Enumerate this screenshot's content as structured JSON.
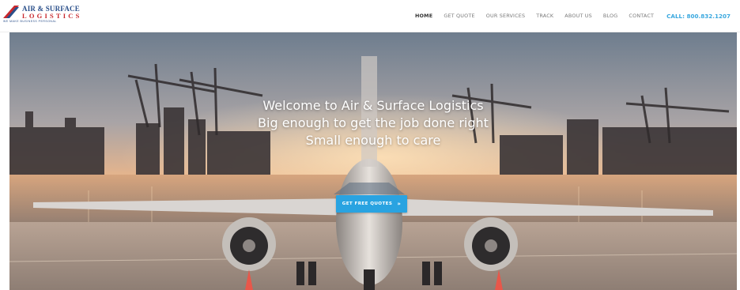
{
  "header": {
    "logo": {
      "line1": "AIR & SURFACE",
      "line2": "LOGISTICS",
      "tagline": "WE MAKE BUSINESS PERSONAL"
    },
    "nav": [
      {
        "label": "HOME",
        "active": true
      },
      {
        "label": "GET QUOTE",
        "active": false
      },
      {
        "label": "OUR SERVICES",
        "active": false
      },
      {
        "label": "TRACK",
        "active": false
      },
      {
        "label": "ABOUT US",
        "active": false
      },
      {
        "label": "BLOG",
        "active": false
      },
      {
        "label": "CONTACT",
        "active": false
      }
    ],
    "call": "CALL: 800.832.1207"
  },
  "hero": {
    "line1": "Welcome to Air & Surface Logistics",
    "line2": "Big enough to get the job done right",
    "line3": "Small enough to care",
    "cta_label": "GET FREE QUOTES",
    "cta_arrow": "»"
  },
  "colors": {
    "accent": "#29a3e1",
    "call": "#3aa8df",
    "logo_blue": "#2a4f8a",
    "logo_red": "#c8282d"
  },
  "icons": {
    "logo_mark": "stripes-logo-icon",
    "cta_arrow": "double-chevron-right-icon"
  }
}
